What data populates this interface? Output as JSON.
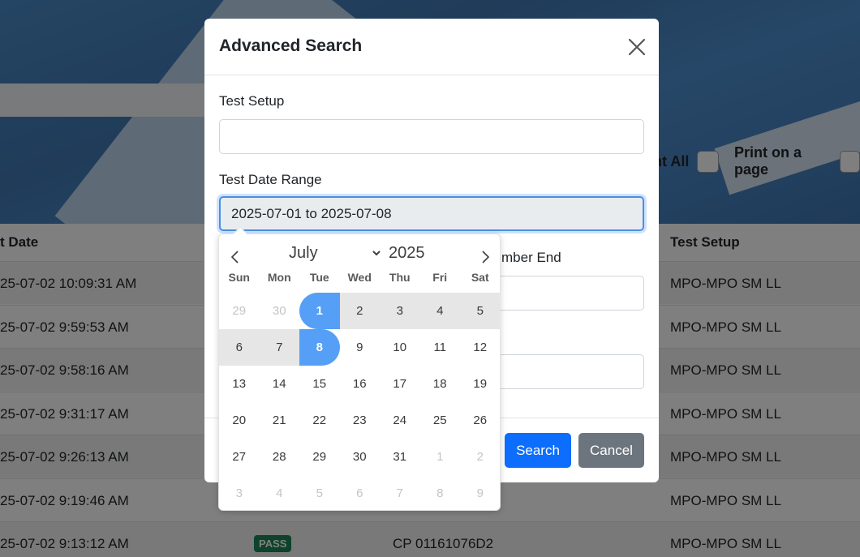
{
  "background": {
    "print_all_label": "int All",
    "print_on_page_label": "Print on a page",
    "table": {
      "headers": {
        "date": "t Date",
        "setup": "Test Setup"
      },
      "rows": [
        {
          "date": "25-07-02 10:09:31 AM",
          "serial": "",
          "setup": "MPO-MPO SM LL",
          "badge": ""
        },
        {
          "date": "25-07-02 9:59:53 AM",
          "serial": "",
          "setup": "MPO-MPO SM LL",
          "badge": ""
        },
        {
          "date": "25-07-02 9:58:16 AM",
          "serial": "",
          "setup": "MPO-MPO SM LL",
          "badge": ""
        },
        {
          "date": "25-07-02 9:31:17 AM",
          "serial": "",
          "setup": "MPO-MPO SM LL",
          "badge": ""
        },
        {
          "date": "25-07-02 9:26:13 AM",
          "serial": "",
          "setup": "MPO-MPO SM LL",
          "badge": ""
        },
        {
          "date": "25-07-02 9:19:46 AM",
          "serial": "",
          "setup": "MPO-MPO SM LL",
          "badge": ""
        },
        {
          "date": "25-07-02 9:13:12 AM",
          "serial": "CP 01161076D2",
          "setup": "MPO-MPO SM LL",
          "badge": "PASS"
        }
      ]
    }
  },
  "modal": {
    "title": "Advanced Search",
    "fields": {
      "test_setup_label": "Test Setup",
      "test_setup_value": "",
      "date_range_label": "Test Date Range",
      "date_range_value": "2025-07-01 to 2025-07-08",
      "serial_end_label_partial": "mber End"
    },
    "buttons": {
      "search": "Search",
      "cancel": "Cancel"
    }
  },
  "datepicker": {
    "month": "July",
    "year": "2025",
    "weekdays": [
      "Sun",
      "Mon",
      "Tue",
      "Wed",
      "Thu",
      "Fri",
      "Sat"
    ],
    "weeks": [
      [
        {
          "d": "29",
          "s": "other"
        },
        {
          "d": "30",
          "s": "other"
        },
        {
          "d": "1",
          "s": "start"
        },
        {
          "d": "2",
          "s": "inrange"
        },
        {
          "d": "3",
          "s": "inrange"
        },
        {
          "d": "4",
          "s": "inrange"
        },
        {
          "d": "5",
          "s": "inrange"
        }
      ],
      [
        {
          "d": "6",
          "s": "inrange"
        },
        {
          "d": "7",
          "s": "inrange"
        },
        {
          "d": "8",
          "s": "end"
        },
        {
          "d": "9",
          "s": ""
        },
        {
          "d": "10",
          "s": ""
        },
        {
          "d": "11",
          "s": ""
        },
        {
          "d": "12",
          "s": ""
        }
      ],
      [
        {
          "d": "13",
          "s": ""
        },
        {
          "d": "14",
          "s": ""
        },
        {
          "d": "15",
          "s": ""
        },
        {
          "d": "16",
          "s": ""
        },
        {
          "d": "17",
          "s": ""
        },
        {
          "d": "18",
          "s": ""
        },
        {
          "d": "19",
          "s": ""
        }
      ],
      [
        {
          "d": "20",
          "s": ""
        },
        {
          "d": "21",
          "s": ""
        },
        {
          "d": "22",
          "s": ""
        },
        {
          "d": "23",
          "s": ""
        },
        {
          "d": "24",
          "s": ""
        },
        {
          "d": "25",
          "s": ""
        },
        {
          "d": "26",
          "s": ""
        }
      ],
      [
        {
          "d": "27",
          "s": ""
        },
        {
          "d": "28",
          "s": ""
        },
        {
          "d": "29",
          "s": ""
        },
        {
          "d": "30",
          "s": ""
        },
        {
          "d": "31",
          "s": ""
        },
        {
          "d": "1",
          "s": "other"
        },
        {
          "d": "2",
          "s": "other"
        }
      ],
      [
        {
          "d": "3",
          "s": "other"
        },
        {
          "d": "4",
          "s": "other"
        },
        {
          "d": "5",
          "s": "other"
        },
        {
          "d": "6",
          "s": "other"
        },
        {
          "d": "7",
          "s": "other"
        },
        {
          "d": "8",
          "s": "other"
        },
        {
          "d": "9",
          "s": "other"
        }
      ]
    ],
    "colors": {
      "selected": "#569ff7",
      "in_range": "#e6e6e6"
    }
  },
  "icons": {
    "close": "close-icon",
    "prev": "chevron-left-icon",
    "next": "chevron-right-icon",
    "month_dropdown": "chevron-down-icon"
  }
}
